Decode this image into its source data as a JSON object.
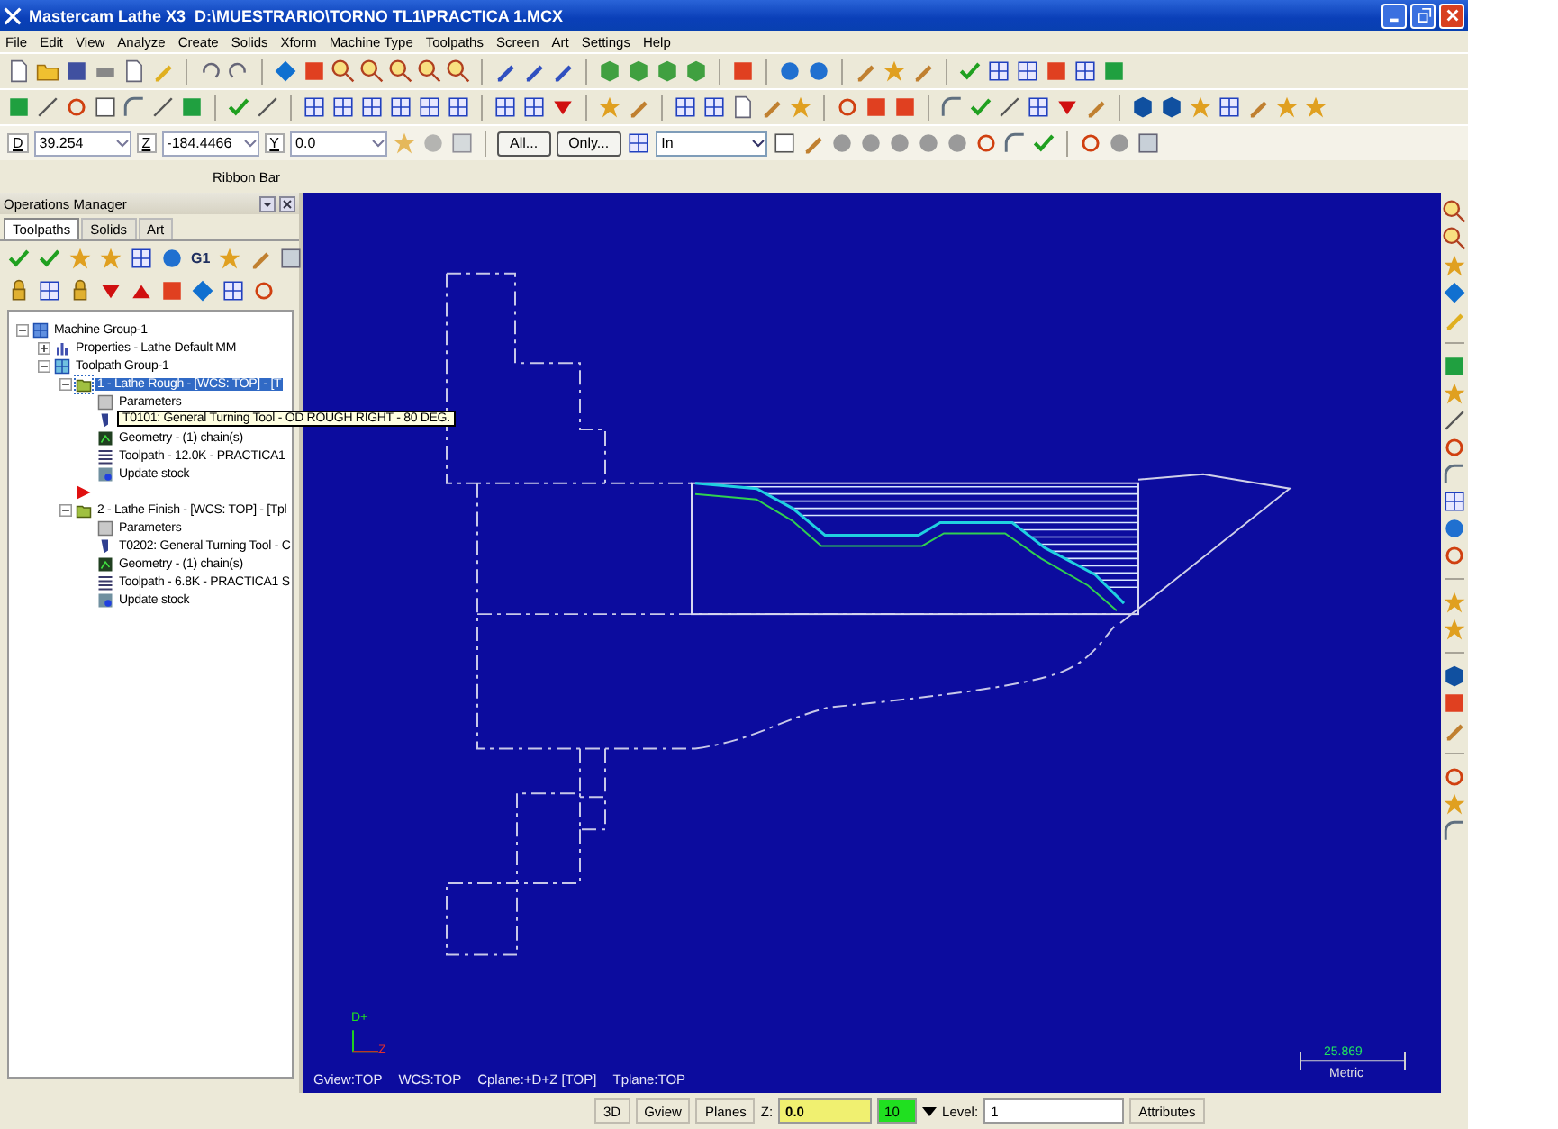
{
  "window": {
    "title": "Mastercam Lathe X3  D:\\MUESTRARIO\\TORNO TL1\\PRACTICA 1.MCX"
  },
  "menu": [
    "File",
    "Edit",
    "View",
    "Analyze",
    "Create",
    "Solids",
    "Xform",
    "Machine Type",
    "Toolpaths",
    "Screen",
    "Art",
    "Settings",
    "Help"
  ],
  "ribbon": {
    "fields": [
      {
        "label": "D",
        "value": "39.254"
      },
      {
        "label": "Z",
        "value": "-184.4466"
      },
      {
        "label": "Y",
        "value": "0.0"
      }
    ],
    "buttons": [
      "All...",
      "Only..."
    ],
    "select": "In",
    "caption": "Ribbon Bar"
  },
  "operations_manager": {
    "title": "Operations Manager",
    "tabs": [
      {
        "label": "Toolpaths",
        "selected": true
      },
      {
        "label": "Solids",
        "selected": false
      },
      {
        "label": "Art",
        "selected": false
      }
    ],
    "gcode_button": "G1",
    "tree": [
      {
        "kind": "machine",
        "label": "Machine Group-1",
        "expanded": true,
        "selected": false,
        "children": [
          {
            "kind": "properties",
            "label": "Properties - Lathe Default MM",
            "expanded": false,
            "selected": false
          },
          {
            "kind": "group",
            "label": "Toolpath Group-1",
            "expanded": true,
            "selected": false,
            "children": [
              {
                "kind": "operation",
                "label": "1 - Lathe Rough - [WCS: TOP] - [T",
                "expanded": true,
                "selected": true,
                "children": [
                  {
                    "kind": "parameters",
                    "label": "Parameters",
                    "selected": false
                  },
                  {
                    "kind": "tool",
                    "tooltip": "T0101: General Turning Tool - OD ROUGH RIGHT - 80 DEG.",
                    "selected": false
                  },
                  {
                    "kind": "geometry",
                    "label": "Geometry - (1) chain(s)",
                    "selected": false
                  },
                  {
                    "kind": "toolpath",
                    "label": "Toolpath - 12.0K - PRACTICA1",
                    "selected": false
                  },
                  {
                    "kind": "stock",
                    "label": "Update stock",
                    "selected": false
                  }
                ]
              },
              {
                "kind": "marker",
                "selected": false
              },
              {
                "kind": "operation",
                "label": "2 - Lathe Finish - [WCS: TOP] - [Tpl",
                "expanded": true,
                "selected": false,
                "children": [
                  {
                    "kind": "parameters",
                    "label": "Parameters",
                    "selected": false
                  },
                  {
                    "kind": "tool",
                    "label": "T0202: General Turning Tool - C",
                    "selected": false
                  },
                  {
                    "kind": "geometry",
                    "label": "Geometry - (1) chain(s)",
                    "selected": false
                  },
                  {
                    "kind": "toolpath",
                    "label": "Toolpath - 6.8K - PRACTICA1 S",
                    "selected": false
                  },
                  {
                    "kind": "stock",
                    "label": "Update stock",
                    "selected": false
                  }
                ]
              }
            ]
          }
        ]
      }
    ]
  },
  "viewport": {
    "status": [
      "Gview:TOP",
      "WCS:TOP",
      "Cplane:+D+Z [TOP]",
      "Tplane:TOP"
    ],
    "axis": {
      "vertical": "D+",
      "horizontal": "Z"
    },
    "scale": {
      "value": "25.869",
      "unit": "Metric"
    }
  },
  "status_bar": {
    "buttons": [
      "3D",
      "Gview",
      "Planes"
    ],
    "z_label": "Z:",
    "z_value": "0.0",
    "color_value": "10",
    "level_label": "Level:",
    "level_value": "1",
    "attributes": "Attributes"
  }
}
